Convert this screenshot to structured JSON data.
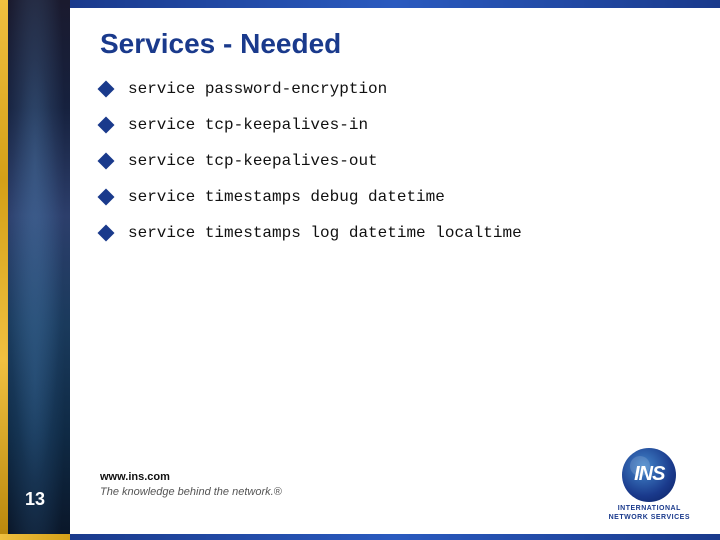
{
  "sidebar": {
    "slide_number": "13"
  },
  "header": {
    "title": "Services -  Needed"
  },
  "bullets": [
    {
      "keyword": "service",
      "description": "password-encryption"
    },
    {
      "keyword": "service",
      "description": "tcp-keepalives-in"
    },
    {
      "keyword": "service",
      "description": "tcp-keepalives-out"
    },
    {
      "keyword": "service",
      "description": "timestamps debug datetime"
    },
    {
      "keyword": "service",
      "description": "timestamps log datetime localtime"
    }
  ],
  "footer": {
    "url": "www.ins.com",
    "tagline": "The knowledge behind the network.®"
  },
  "logo": {
    "text": "INS",
    "label_line1": "INTERNATIONAL",
    "label_line2": "NETWORK SERVICES"
  }
}
